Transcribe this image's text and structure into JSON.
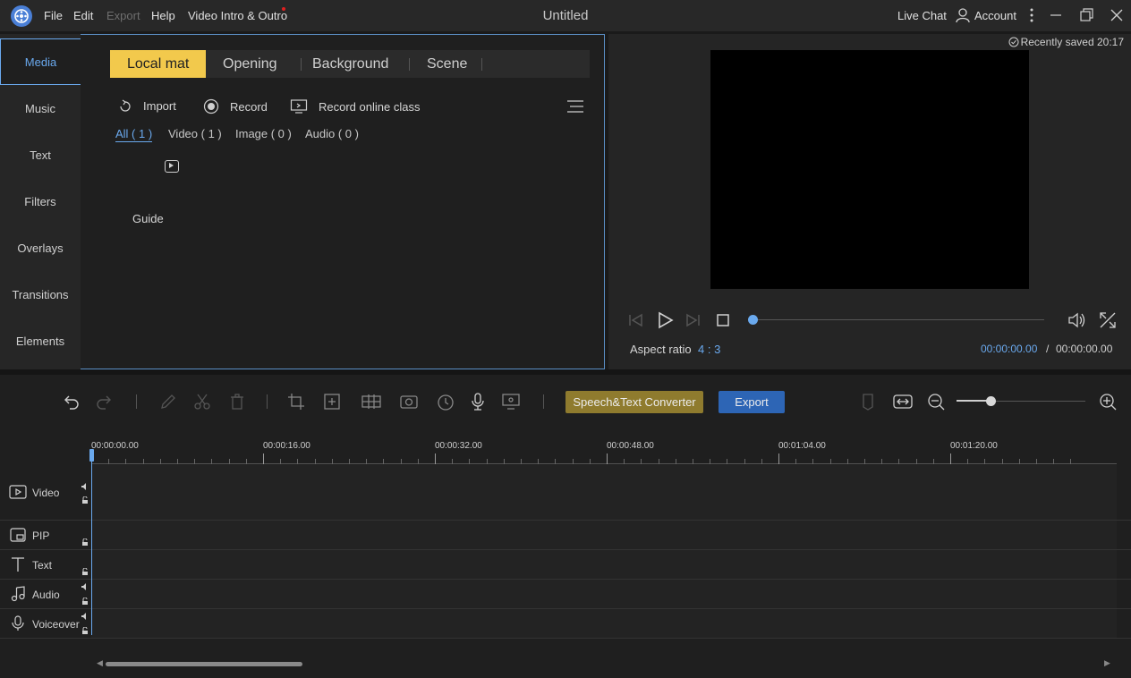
{
  "app": {
    "window_title": "Untitled",
    "menu": [
      "File",
      "Edit",
      "Export",
      "Help",
      "Video Intro & Outro"
    ],
    "live_chat": "Live Chat",
    "account": "Account",
    "accent_color": "#6aa9ee"
  },
  "sidebar": {
    "items": [
      {
        "label": "Media",
        "active": true
      },
      {
        "label": "Music"
      },
      {
        "label": "Text"
      },
      {
        "label": "Filters"
      },
      {
        "label": "Overlays"
      },
      {
        "label": "Transitions"
      },
      {
        "label": "Elements"
      }
    ]
  },
  "media": {
    "tabs": [
      {
        "label": "Local mat",
        "active": true
      },
      {
        "label": "Opening"
      },
      {
        "label": "Background"
      },
      {
        "label": "Scene"
      }
    ],
    "actions": {
      "import": "Import",
      "record": "Record",
      "record_online": "Record online class"
    },
    "filters": [
      {
        "label": "All ( 1 )",
        "active": true
      },
      {
        "label": "Video ( 1 )"
      },
      {
        "label": "Image ( 0 )"
      },
      {
        "label": "Audio ( 0 )"
      }
    ],
    "guide_label": "Guide"
  },
  "preview": {
    "saved": "Recently saved 20:17",
    "aspect_label": "Aspect ratio",
    "aspect_value": "4 : 3",
    "time_current": "00:00:00.00",
    "time_separator": "/",
    "time_total": "00:00:00.00",
    "progress": 0
  },
  "toolbar": {
    "stt_label": "Speech&Text Converter",
    "export_label": "Export",
    "zoom_level": 0.26
  },
  "timeline": {
    "ruler": [
      "00:00:00.00",
      "00:00:16.00",
      "00:00:32.00",
      "00:00:48.00",
      "00:01:04.00",
      "00:01:20.00"
    ],
    "tracks": [
      {
        "name": "Video",
        "icon": "video-track-icon"
      },
      {
        "name": "PIP",
        "icon": "pip-track-icon"
      },
      {
        "name": "Text",
        "icon": "text-track-icon"
      },
      {
        "name": "Audio",
        "icon": "music-note-icon"
      },
      {
        "name": "Voiceover",
        "icon": "microphone-icon"
      }
    ]
  }
}
